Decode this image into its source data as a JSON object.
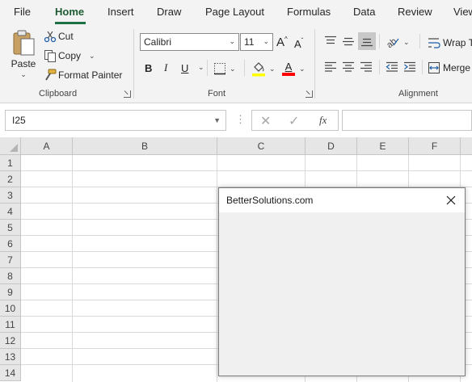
{
  "menu": {
    "tabs": [
      "File",
      "Home",
      "Insert",
      "Draw",
      "Page Layout",
      "Formulas",
      "Data",
      "Review",
      "View"
    ],
    "active": "Home"
  },
  "ribbon": {
    "clipboard": {
      "paste_label": "Paste",
      "cut_label": "Cut",
      "copy_label": "Copy",
      "format_painter_label": "Format Painter",
      "group_label": "Clipboard"
    },
    "font": {
      "font_name": "Calibri",
      "font_size": "11",
      "bold": "B",
      "italic": "I",
      "underline": "U",
      "group_label": "Font",
      "fill_color": "#ffff00",
      "font_color": "#ff0000",
      "grow_label": "A",
      "shrink_label": "A",
      "font_color_letter": "A"
    },
    "alignment": {
      "wrap_label": "Wrap T",
      "merge_label": "Merge",
      "group_label": "Alignment"
    }
  },
  "formula_bar": {
    "name_box": "I25",
    "fx_label": "fx",
    "formula": ""
  },
  "grid": {
    "columns": [
      "A",
      "B",
      "C",
      "D",
      "E",
      "F"
    ],
    "rows": [
      "1",
      "2",
      "3",
      "4",
      "5",
      "6",
      "7",
      "8",
      "9",
      "10",
      "11",
      "12",
      "13",
      "14"
    ]
  },
  "dialog": {
    "title": "BetterSolutions.com"
  },
  "colors": {
    "accent": "#1e7145",
    "ribbon_bg": "#f3f3f3",
    "header_bg": "#e6e6e6"
  }
}
